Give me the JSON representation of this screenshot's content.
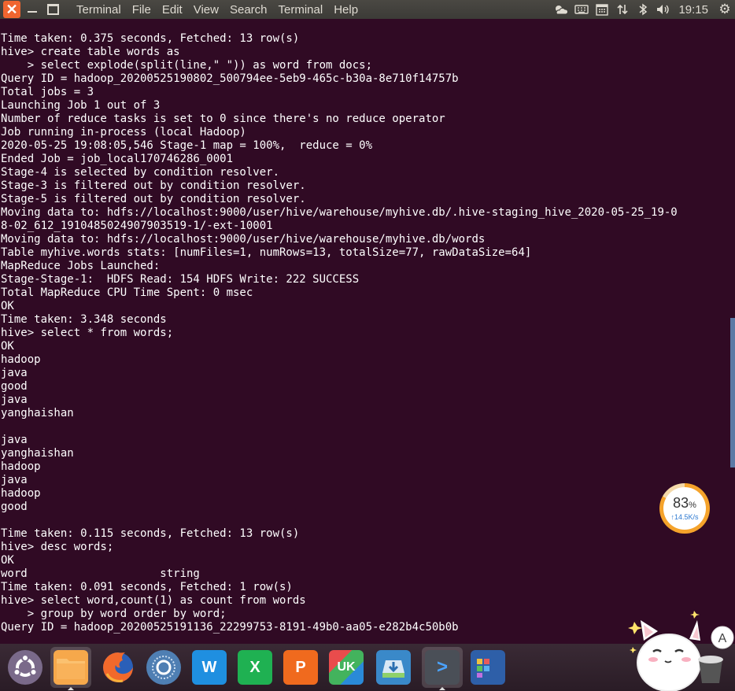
{
  "menubar": {
    "close_glyph": "✕",
    "items": [
      "Terminal",
      "File",
      "Edit",
      "View",
      "Search",
      "Terminal",
      "Help"
    ],
    "tray_icons": [
      "weather-icon",
      "keyboard-icon",
      "calendar-icon",
      "network-arrows-icon",
      "bluetooth-icon",
      "volume-icon"
    ],
    "clock": "19:15"
  },
  "terminal": {
    "lines": [
      "Time taken: 0.375 seconds, Fetched: 13 row(s)",
      "hive> create table words as",
      "    > select explode(split(line,\" \")) as word from docs;",
      "Query ID = hadoop_20200525190802_500794ee-5eb9-465c-b30a-8e710f14757b",
      "Total jobs = 3",
      "Launching Job 1 out of 3",
      "Number of reduce tasks is set to 0 since there's no reduce operator",
      "Job running in-process (local Hadoop)",
      "2020-05-25 19:08:05,546 Stage-1 map = 100%,  reduce = 0%",
      "Ended Job = job_local170746286_0001",
      "Stage-4 is selected by condition resolver.",
      "Stage-3 is filtered out by condition resolver.",
      "Stage-5 is filtered out by condition resolver.",
      "Moving data to: hdfs://localhost:9000/user/hive/warehouse/myhive.db/.hive-staging_hive_2020-05-25_19-0",
      "8-02_612_1910485024907903519-1/-ext-10001",
      "Moving data to: hdfs://localhost:9000/user/hive/warehouse/myhive.db/words",
      "Table myhive.words stats: [numFiles=1, numRows=13, totalSize=77, rawDataSize=64]",
      "MapReduce Jobs Launched:",
      "Stage-Stage-1:  HDFS Read: 154 HDFS Write: 222 SUCCESS",
      "Total MapReduce CPU Time Spent: 0 msec",
      "OK",
      "Time taken: 3.348 seconds",
      "hive> select * from words;",
      "OK",
      "hadoop",
      "java",
      "good",
      "java",
      "yanghaishan",
      "",
      "java",
      "yanghaishan",
      "hadoop",
      "java",
      "hadoop",
      "good",
      "",
      "Time taken: 0.115 seconds, Fetched: 13 row(s)",
      "hive> desc words;",
      "OK",
      "word                    string",
      "Time taken: 0.091 seconds, Fetched: 1 row(s)",
      "hive> select word,count(1) as count from words",
      "    > group by word order by word;",
      "Query ID = hadoop_20200525191136_22299753-8191-49b0-aa05-e282b4c50b0b"
    ]
  },
  "network_widget": {
    "percent": "83",
    "percent_unit": "%",
    "speed": "↑14.5K/s",
    "fill": 0.83
  },
  "dock": {
    "items": [
      {
        "name": "ubuntu-launcher-icon",
        "label": ""
      },
      {
        "name": "files-folder-icon",
        "label": ""
      },
      {
        "name": "firefox-icon",
        "label": ""
      },
      {
        "name": "screenshot-tool-icon",
        "label": ""
      },
      {
        "name": "wps-writer-icon",
        "label": "W"
      },
      {
        "name": "wps-spreadsheet-icon",
        "label": "X"
      },
      {
        "name": "wps-presentation-icon",
        "label": "P"
      },
      {
        "name": "ubuntu-kylin-store-icon",
        "label": "UK"
      },
      {
        "name": "software-updater-icon",
        "label": ""
      },
      {
        "name": "terminal-icon",
        "label": ">"
      },
      {
        "name": "workspace-switcher-icon",
        "label": ""
      }
    ]
  },
  "colors": {
    "terminal_bg": "#300a24",
    "menubar_bg": "#3c3b37",
    "close_orange": "#f0652f"
  }
}
